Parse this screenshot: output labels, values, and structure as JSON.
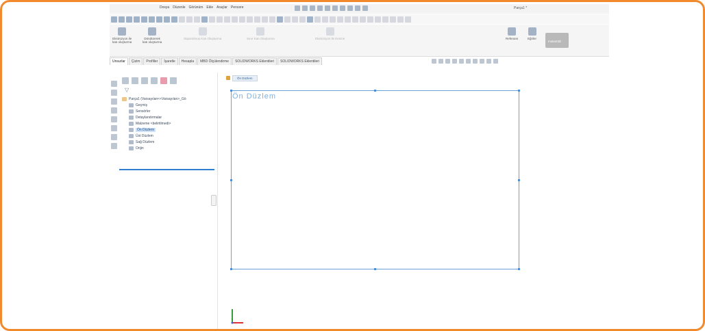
{
  "app": {
    "document_title": "Parça1 *",
    "menus": [
      "Dosya",
      "Düzenle",
      "Görünüm",
      "Ekle",
      "Araçlar",
      "Pencere"
    ],
    "accent_color": "#f08a2c"
  },
  "ribbon": {
    "groups": [
      {
        "label_1": "Ekstrüzyon ile",
        "label_2": "katı oluşturma",
        "enabled": true
      },
      {
        "label_1": "Döndürerek",
        "label_2": "katı oluşturma",
        "enabled": true
      },
      {
        "label_1": "Süpürülmüş Katı Oluşturma",
        "label_2": "",
        "enabled": false
      },
      {
        "label_1": "Sınır Katı Oluşturma",
        "label_2": "",
        "enabled": false
      },
      {
        "label_1": "Ekstrüzyon ile Kesme",
        "label_2": "",
        "enabled": false
      },
      {
        "label_1": "Referans",
        "label_2": "",
        "enabled": true
      },
      {
        "label_1": "Eğriler",
        "label_2": "",
        "enabled": true
      },
      {
        "label_1": "Instant3D",
        "label_2": "",
        "enabled": true
      }
    ]
  },
  "tabs": [
    {
      "label": "Unsurlar",
      "active": true
    },
    {
      "label": "Çizim",
      "active": false
    },
    {
      "label": "Profiller",
      "active": false
    },
    {
      "label": "İşaretle",
      "active": false
    },
    {
      "label": "Hesapla",
      "active": false
    },
    {
      "label": "MBD Ölçülendirme",
      "active": false
    },
    {
      "label": "SOLIDWORKS Eklentileri",
      "active": false
    },
    {
      "label": "SOLIDWORKS Eklentileri",
      "active": false
    }
  ],
  "tree": {
    "root": "Parça1 (Varsayılan<<Varsayılan>_Gö",
    "items": [
      {
        "label": "Geçmiş",
        "indent": 1,
        "selected": false
      },
      {
        "label": "Sensörler",
        "indent": 1,
        "selected": false
      },
      {
        "label": "Detaylandırmalar",
        "indent": 1,
        "selected": false
      },
      {
        "label": "Malzeme <belirtilmedi>",
        "indent": 1,
        "selected": false
      },
      {
        "label": "Ön Düzlem",
        "indent": 1,
        "selected": true
      },
      {
        "label": "Üst Düzlem",
        "indent": 1,
        "selected": false
      },
      {
        "label": "Sağ Düzlem",
        "indent": 1,
        "selected": false
      },
      {
        "label": "Orijin",
        "indent": 1,
        "selected": false
      }
    ]
  },
  "graphics": {
    "breadcrumb_label": "Ön Düzlem",
    "plane_label": "Ön Düzlem",
    "plane_color": "#6aa0da"
  }
}
